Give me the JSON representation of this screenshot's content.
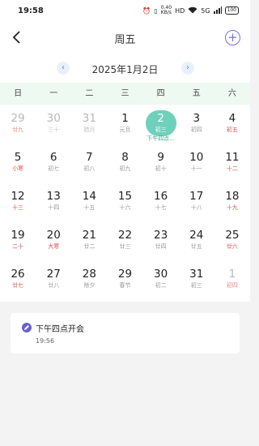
{
  "status_bar": {
    "time": "19:58",
    "net_speed": "0.40",
    "net_unit": "KB/s",
    "network": "5G",
    "battery": "100"
  },
  "header": {
    "title": "周五",
    "add_icon": "plus-circle-icon",
    "back_icon": "chevron-left-icon"
  },
  "month_nav": {
    "label": "2025年1月2日",
    "prev": "‹",
    "next": "›"
  },
  "weekdays": [
    "日",
    "一",
    "二",
    "三",
    "四",
    "五",
    "六"
  ],
  "calendar": {
    "selected_color": "#6fd0bb",
    "holiday_color": "#d9534f",
    "days": [
      {
        "num": "29",
        "sub": "廿九",
        "other": true,
        "red": true
      },
      {
        "num": "30",
        "sub": "三十",
        "other": true
      },
      {
        "num": "31",
        "sub": "腊月",
        "other": true
      },
      {
        "num": "1",
        "sub": "元旦"
      },
      {
        "num": "2",
        "sub": "初三",
        "selected": true,
        "event": "下午四点..."
      },
      {
        "num": "3",
        "sub": "初四"
      },
      {
        "num": "4",
        "sub": "初五",
        "red": true
      },
      {
        "num": "5",
        "sub": "小寒",
        "red": true
      },
      {
        "num": "6",
        "sub": "初七"
      },
      {
        "num": "7",
        "sub": "初八"
      },
      {
        "num": "8",
        "sub": "初九"
      },
      {
        "num": "9",
        "sub": "初十"
      },
      {
        "num": "10",
        "sub": "十一"
      },
      {
        "num": "11",
        "sub": "十二",
        "red": true
      },
      {
        "num": "12",
        "sub": "十三",
        "red": true
      },
      {
        "num": "13",
        "sub": "十四"
      },
      {
        "num": "14",
        "sub": "十五"
      },
      {
        "num": "15",
        "sub": "十六"
      },
      {
        "num": "16",
        "sub": "十七"
      },
      {
        "num": "17",
        "sub": "十八"
      },
      {
        "num": "18",
        "sub": "十九",
        "red": true
      },
      {
        "num": "19",
        "sub": "二十",
        "red": true
      },
      {
        "num": "20",
        "sub": "大寒",
        "red": true
      },
      {
        "num": "21",
        "sub": "廿二"
      },
      {
        "num": "22",
        "sub": "廿三"
      },
      {
        "num": "23",
        "sub": "廿四"
      },
      {
        "num": "24",
        "sub": "廿五"
      },
      {
        "num": "25",
        "sub": "廿六",
        "red": true
      },
      {
        "num": "26",
        "sub": "廿七",
        "red": true
      },
      {
        "num": "27",
        "sub": "廿八"
      },
      {
        "num": "28",
        "sub": "除夕"
      },
      {
        "num": "29",
        "sub": "春节"
      },
      {
        "num": "30",
        "sub": "初二"
      },
      {
        "num": "31",
        "sub": "初三"
      },
      {
        "num": "1",
        "sub": "初四",
        "other": true,
        "red": true
      }
    ]
  },
  "event": {
    "title": "下午四点开会",
    "time": "19:56",
    "icon": "pencil-icon",
    "icon_color": "#6b5fd1"
  }
}
